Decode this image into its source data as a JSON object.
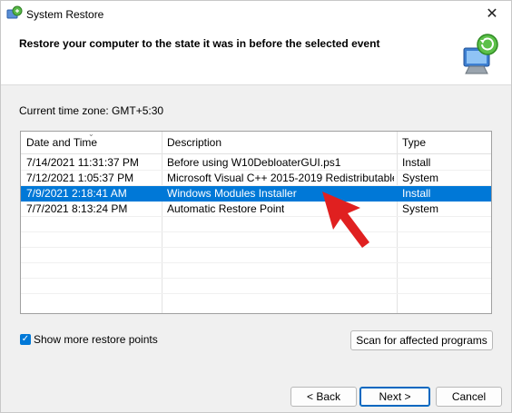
{
  "window": {
    "title": "System Restore",
    "close_glyph": "✕"
  },
  "header": {
    "title": "Restore your computer to the state it was in before the selected event"
  },
  "timezone": {
    "label": "Current time zone: GMT+5:30"
  },
  "list": {
    "columns": [
      "Date and Time",
      "Description",
      "Type"
    ],
    "rows": [
      {
        "date": "7/14/2021 11:31:37 PM",
        "desc": "Before using W10DebloaterGUI.ps1",
        "type": "Install"
      },
      {
        "date": "7/12/2021 1:05:37 PM",
        "desc": "Microsoft Visual C++ 2015-2019 Redistributable ...",
        "type": "System"
      },
      {
        "date": "7/9/2021 2:18:41 AM",
        "desc": "Windows Modules Installer",
        "type": "Install"
      },
      {
        "date": "7/7/2021 8:13:24 PM",
        "desc": "Automatic Restore Point",
        "type": "System"
      }
    ],
    "selected_index": 2
  },
  "options": {
    "show_more_label": "Show more restore points",
    "show_more_checked": true
  },
  "buttons": {
    "scan": "Scan for affected programs",
    "back": "< Back",
    "next": "Next >",
    "cancel": "Cancel"
  },
  "colors": {
    "accent": "#0078d7",
    "annotation_arrow": "#e02020"
  },
  "icons": {
    "app": "system-restore-icon",
    "header": "computer-restore-icon"
  }
}
